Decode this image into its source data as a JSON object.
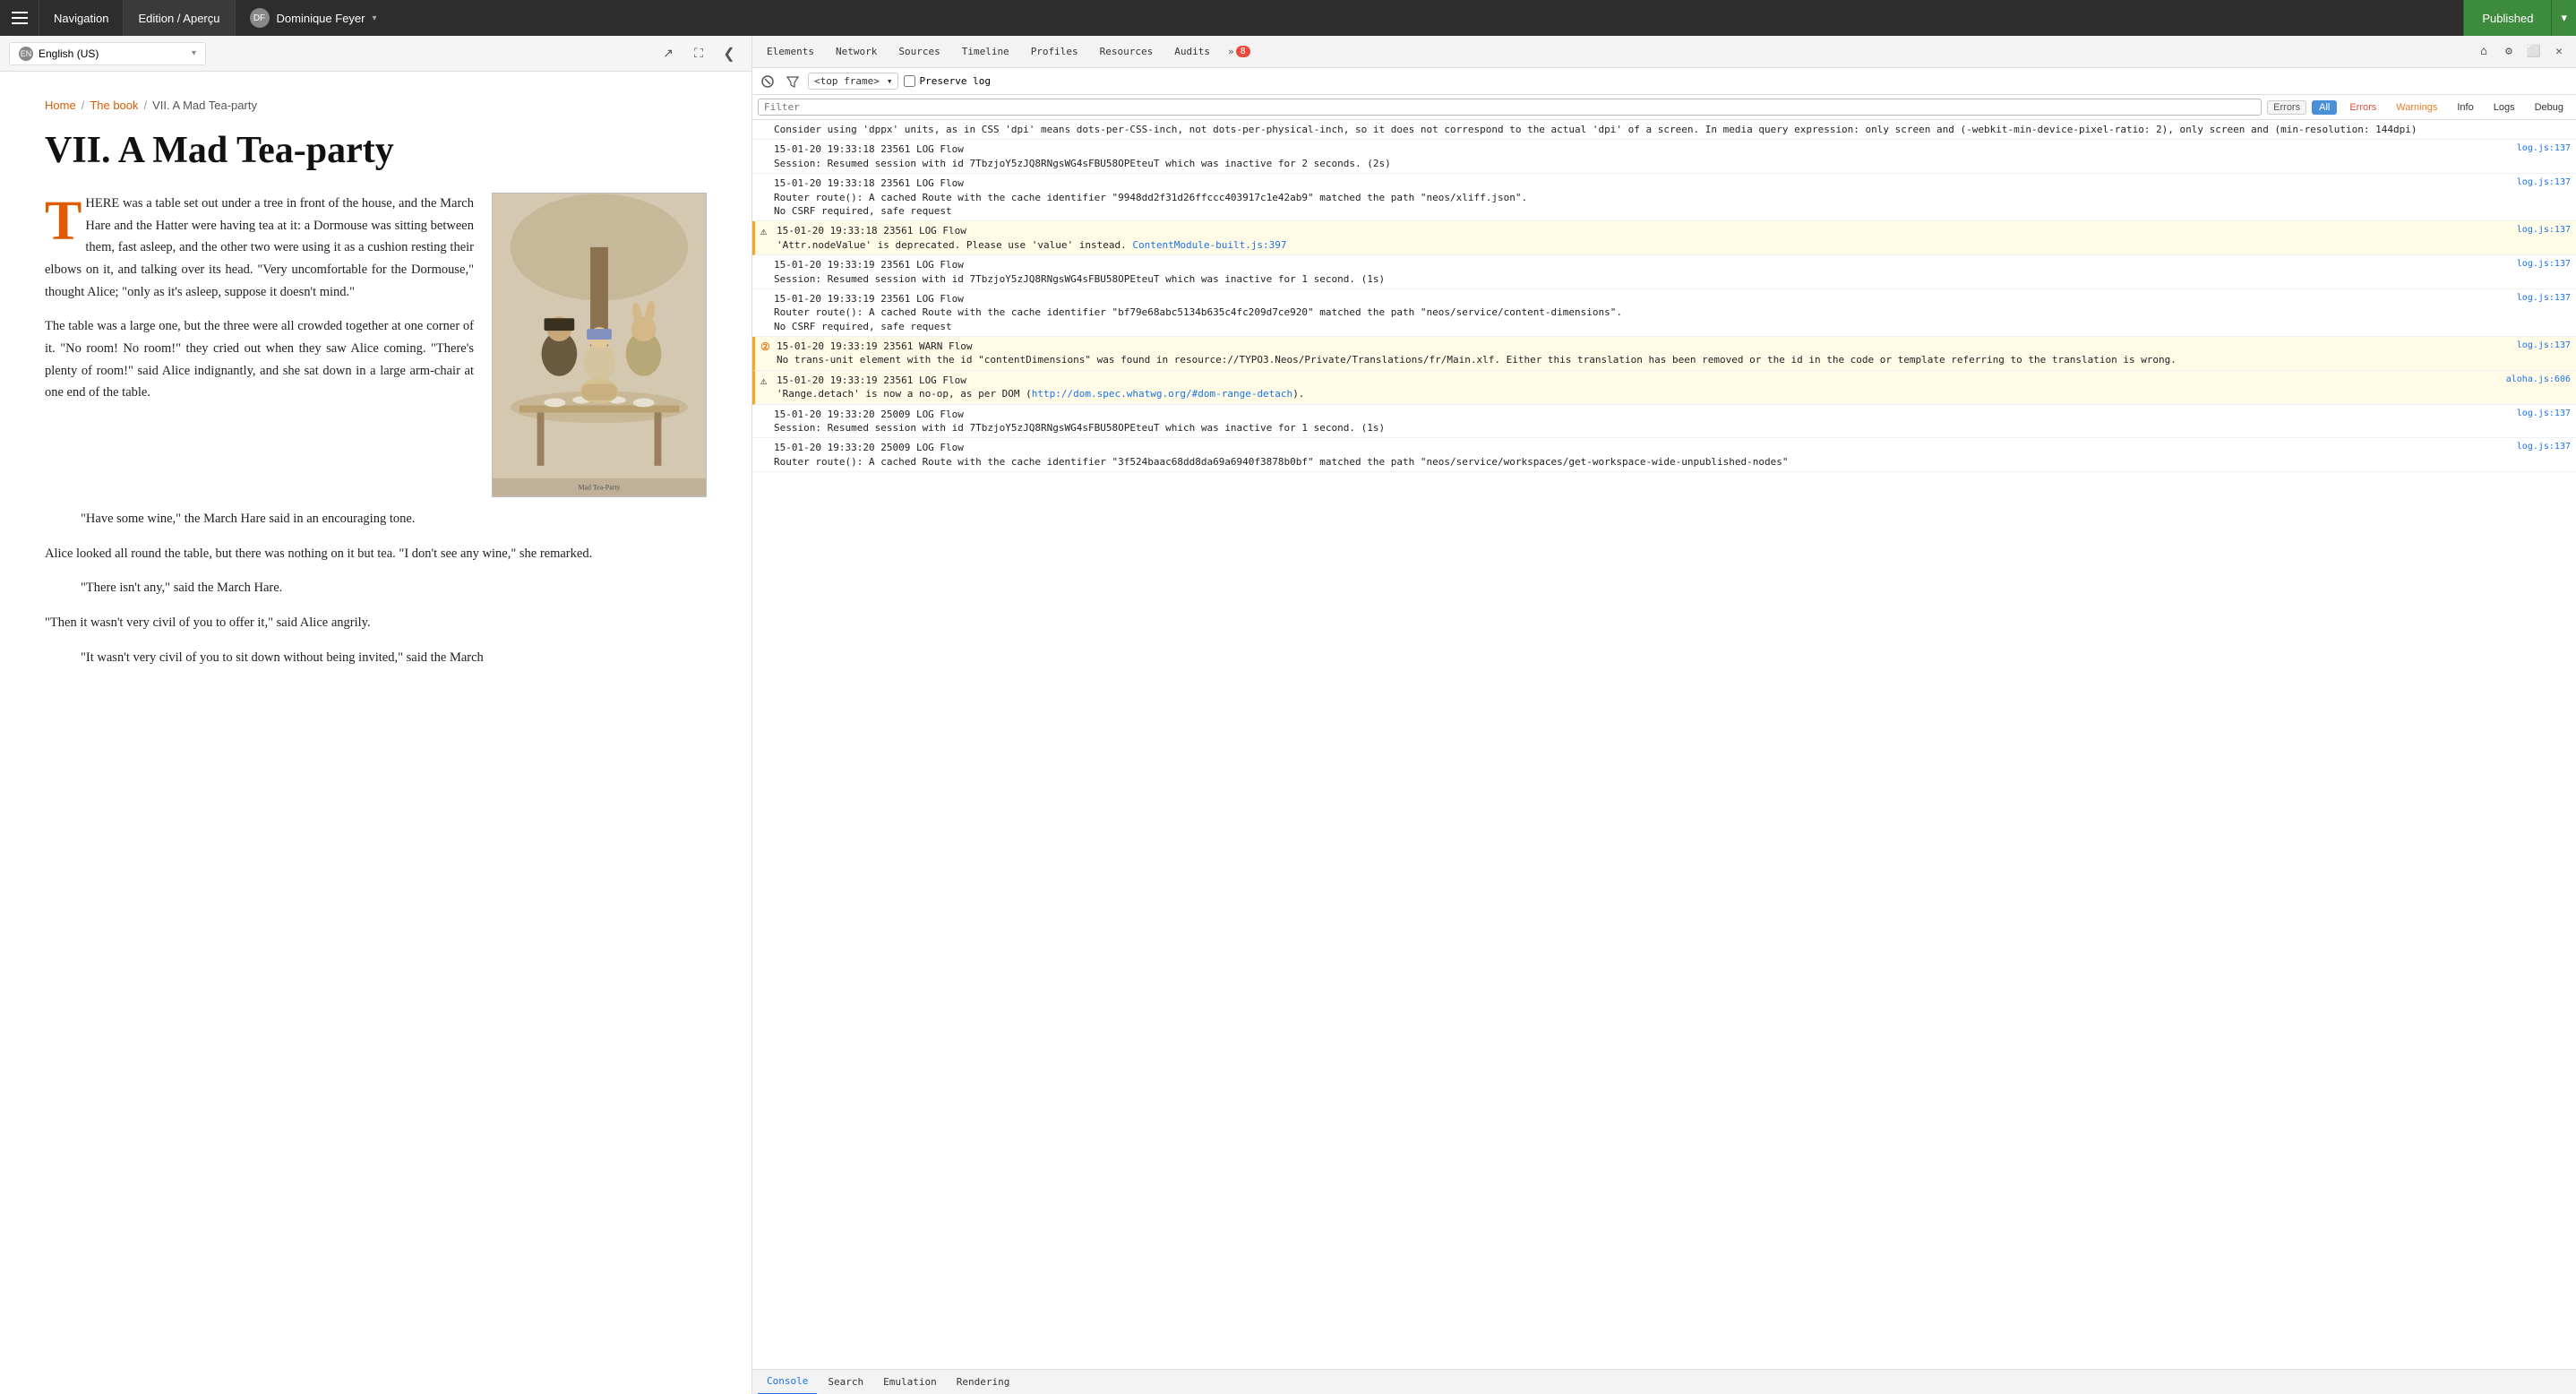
{
  "topbar": {
    "nav_label": "Navigation",
    "edition_label": "Edition / Aperçu",
    "user_name": "Dominique Feyer",
    "user_initials": "DF",
    "published_label": "Published"
  },
  "toolbar": {
    "lang_label": "English (US)",
    "lang_code": "EN"
  },
  "breadcrumb": {
    "home": "Home",
    "book": "The book",
    "current": "VII. A Mad Tea-party"
  },
  "content": {
    "title": "VII. A Mad Tea-party",
    "paragraphs": [
      "HERE was a table set out under a tree in front of the house, and the March Hare and the Hatter were having tea at it: a Dormouse was sitting between them, fast asleep, and the other two were using it as a cushion resting their elbows on it, and talking over its head. \"Very uncomfortable for the Dormouse,\" thought Alice; \"only as it's asleep, suppose it doesn't mind.\"",
      "The table was a large one, but the three were all crowded together at one corner of it. \"No room! No room!\" they cried out when they saw Alice coming. \"There's plenty of room!\" said Alice indignantly, and she sat down in a large arm-chair at one end of the table.",
      "\"Have some wine,\" the March Hare said in an encouraging tone.",
      "Alice looked all round the table, but there was nothing on it but tea. \"I don't see any wine,\" she remarked.",
      "\"There isn't any,\" said the March Hare.",
      "\"Then it wasn't very civil of you to offer it,\" said Alice angrily.",
      "\"It wasn't very civil of you to sit down without being invited,\" said the March"
    ]
  },
  "devtools": {
    "tabs": [
      "Elements",
      "Network",
      "Sources",
      "Timeline",
      "Profiles",
      "Resources",
      "Audits"
    ],
    "tab_more": "»",
    "badge_count": "8",
    "filter_placeholder": "Filter",
    "frame_label": "<top frame>",
    "preserve_log_label": "Preserve log",
    "level_all": "All",
    "level_errors": "Errors",
    "level_warnings": "Warnings",
    "level_info": "Info",
    "level_logs": "Logs",
    "level_debug": "Debug",
    "logs": [
      {
        "type": "info",
        "text": "Consider using 'dppx' units, as in CSS 'dpi' means dots-per-CSS-inch, not dots-per-physical-inch, so it does not correspond to the actual 'dpi' of a screen. In media query expression: only screen and (-webkit-min-device-pixel-ratio: 2), only screen and (min-resolution: 144dpi)",
        "file": "",
        "timestamp": ""
      },
      {
        "type": "info",
        "text": "15-01-20 19:33:18 23561 LOG Flow\nSession: Resumed session with id 7TbzjoY5zJQ8RNgsWG4sFBU58OPEteuT which was inactive for 2 seconds. (2s)",
        "file": "log.js:137",
        "timestamp": "15-01-20 19:33:18"
      },
      {
        "type": "info",
        "text": "15-01-20 19:33:18 23561 LOG Flow\nRouter route(): A cached Route with the cache identifier \"9948dd2f31d26ffccc403917c1e42ab9\" matched the path \"neos/xliff.json\".\nNo CSRF required, safe request",
        "file": "log.js:137",
        "timestamp": "15-01-20 19:33:18"
      },
      {
        "type": "warn",
        "text": "15-01-20 19:33:18 23561 LOG Flow\n'Attr.nodeValue' is deprecated. Please use 'value' instead.",
        "file_label": "ContentModule-built.js:397",
        "timestamp": "15-01-20 19:33:18"
      },
      {
        "type": "info",
        "text": "15-01-20 19:33:19 23561 LOG Flow\nSession: Resumed session with id 7TbzjoY5zJQ8RNgsWG4sFBU58OPEteuT which was inactive for 1 second. (1s)",
        "file": "log.js:137",
        "timestamp": "15-01-20 19:33:19"
      },
      {
        "type": "info",
        "text": "15-01-20 19:33:19 23561 LOG Flow\nRouter route(): A cached Route with the cache identifier \"bf79e68abc5134b635c4fc209d7ce920\" matched the path \"neos/service/content-dimensions\".\nNo CSRF required, safe request",
        "file": "log.js:137",
        "timestamp": "15-01-20 19:33:19"
      },
      {
        "type": "warn2",
        "text": "15-01-20 19:33:19 23561 WARN Flow\nNo trans-unit element with the id \"contentDimensions\" was found in resource://TYPO3.Neos/Private/Translations/fr/Main.xlf. Either this translation has been removed or the id in the code or template referring to the translation is wrong.",
        "file": "log.js:137",
        "timestamp": "15-01-20 19:33:19"
      },
      {
        "type": "warn",
        "text": "15-01-20 19:33:19 23561 LOG Flow\n'Range.detach' is now a no-op, as per DOM (http://dom.spec.whatwg.org/#dom-range-detach).",
        "file_label": "aloha.js:606",
        "timestamp": "15-01-20 19:33:19"
      },
      {
        "type": "info",
        "text": "15-01-20 19:33:20 25009 LOG Flow\nSession: Resumed session with id 7TbzjoY5zJQ8RNgsWG4sFBU58OPEteuT which was inactive for 1 second. (1s)",
        "file": "log.js:137",
        "timestamp": "15-01-20 19:33:20"
      },
      {
        "type": "info",
        "text": "15-01-20 19:33:20 25009 LOG Flow\nRouter route(): A cached Route with the cache identifier \"3f524baac68dd8da69a6940f3878b0bf\" matched the path \"neos/service/workspaces/get-workspace-wide-unpublished-nodes\"",
        "file": "log.js:137",
        "timestamp": "15-01-20 19:33:20"
      }
    ],
    "bottom_tabs": [
      "Console",
      "Search",
      "Emulation",
      "Rendering"
    ]
  }
}
